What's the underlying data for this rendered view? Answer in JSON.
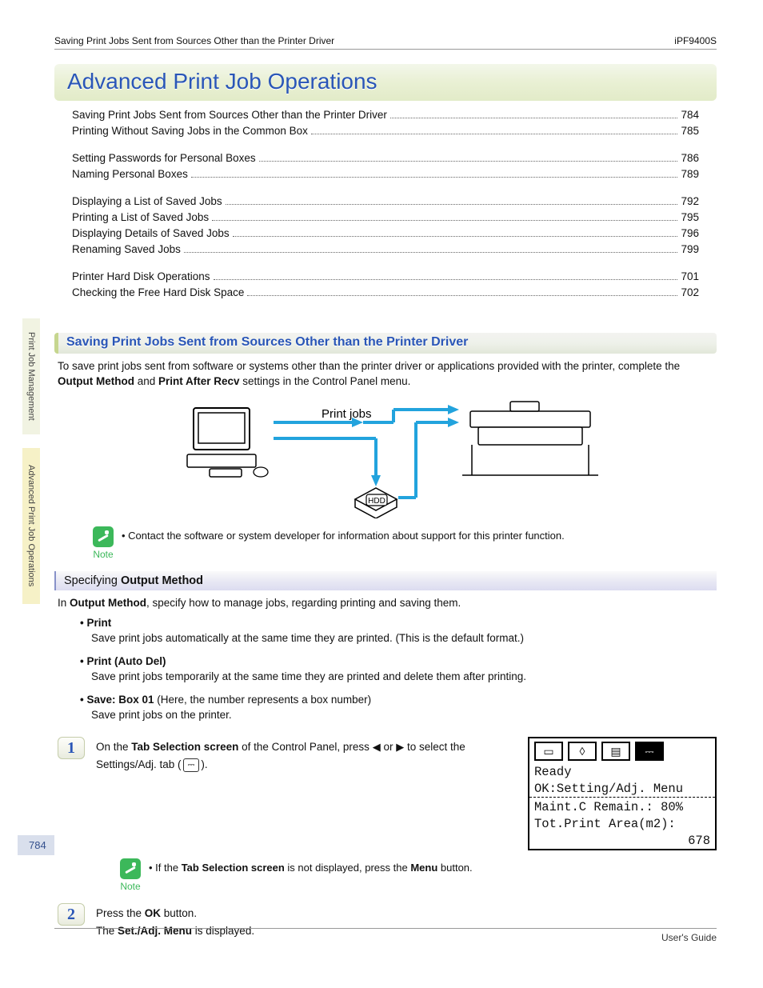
{
  "header": {
    "breadcrumb": "Saving Print Jobs Sent from Sources Other than the Printer Driver",
    "model": "iPF9400S"
  },
  "title": "Advanced Print Job Operations",
  "toc_groups": [
    [
      {
        "label": "Saving Print Jobs Sent from Sources Other than the Printer Driver",
        "page": "784"
      },
      {
        "label": "Printing Without Saving Jobs in the Common Box",
        "page": "785"
      }
    ],
    [
      {
        "label": "Setting Passwords for Personal Boxes",
        "page": "786"
      },
      {
        "label": "Naming Personal Boxes",
        "page": "789"
      }
    ],
    [
      {
        "label": "Displaying a List of Saved Jobs",
        "page": "792"
      },
      {
        "label": "Printing a List of Saved Jobs",
        "page": "795"
      },
      {
        "label": "Displaying Details of Saved Jobs",
        "page": "796"
      },
      {
        "label": "Renaming Saved Jobs",
        "page": "799"
      }
    ],
    [
      {
        "label": "Printer Hard Disk Operations",
        "page": "701"
      },
      {
        "label": "Checking the Free Hard Disk Space",
        "page": "702"
      }
    ]
  ],
  "section": {
    "heading": "Saving Print Jobs Sent from Sources Other than the Printer Driver",
    "intro_a": "To save print jobs sent from software or systems other than the printer driver or applications provided with the printer, complete the ",
    "intro_b": "Output Method",
    "intro_c": " and ",
    "intro_d": "Print After Recv",
    "intro_e": " settings in the Control Panel menu."
  },
  "diagram": {
    "label_jobs": "Print jobs",
    "hdd": "HDD"
  },
  "note1": {
    "label": "Note",
    "text": "Contact the software or system developer for information about support for this printer function."
  },
  "sub": {
    "heading_a": "Specifying ",
    "heading_b": "Output Method",
    "intro_a": "In ",
    "intro_b": "Output Method",
    "intro_c": ", specify how to manage jobs, regarding printing and saving them."
  },
  "options": [
    {
      "title": "Print",
      "desc": "Save print jobs automatically at the same time they are printed. (This is the default format.)"
    },
    {
      "title": "Print (Auto Del)",
      "desc": "Save print jobs temporarily at the same time they are printed and delete them after printing."
    },
    {
      "title": "Save: Box 01",
      "title_suffix": " (Here, the number represents a box number)",
      "desc": "Save print jobs on the printer."
    }
  ],
  "step1": {
    "num": "1",
    "text_a": "On the ",
    "text_b": "Tab Selection screen",
    "text_c": " of the Control Panel, press ",
    "text_d": " or ",
    "text_e": " to select the Settings/Adj. tab (",
    "text_f": ").",
    "icon_glyph": "⎓"
  },
  "panel": {
    "tab1": "▭",
    "tab2": "◊",
    "tab3": "▤",
    "tab4_active": "⎓",
    "line1": "Ready",
    "line2": "OK:Setting/Adj. Menu",
    "line3": "Maint.C Remain.: 80%",
    "line4": "Tot.Print Area(m2):",
    "line5": "678"
  },
  "note2": {
    "label": "Note",
    "text_a": "If the ",
    "text_b": "Tab Selection screen",
    "text_c": " is not displayed, press the ",
    "text_d": "Menu",
    "text_e": " button."
  },
  "step2": {
    "num": "2",
    "text_a": "Press the ",
    "text_b": "OK",
    "text_c": " button.",
    "text_d": "The ",
    "text_e": "Set./Adj. Menu",
    "text_f": " is displayed."
  },
  "sidebar": {
    "a": "Print Job Management",
    "b": "Advanced Print Job Operations"
  },
  "side_pagenum": "784",
  "footer": "User's Guide"
}
